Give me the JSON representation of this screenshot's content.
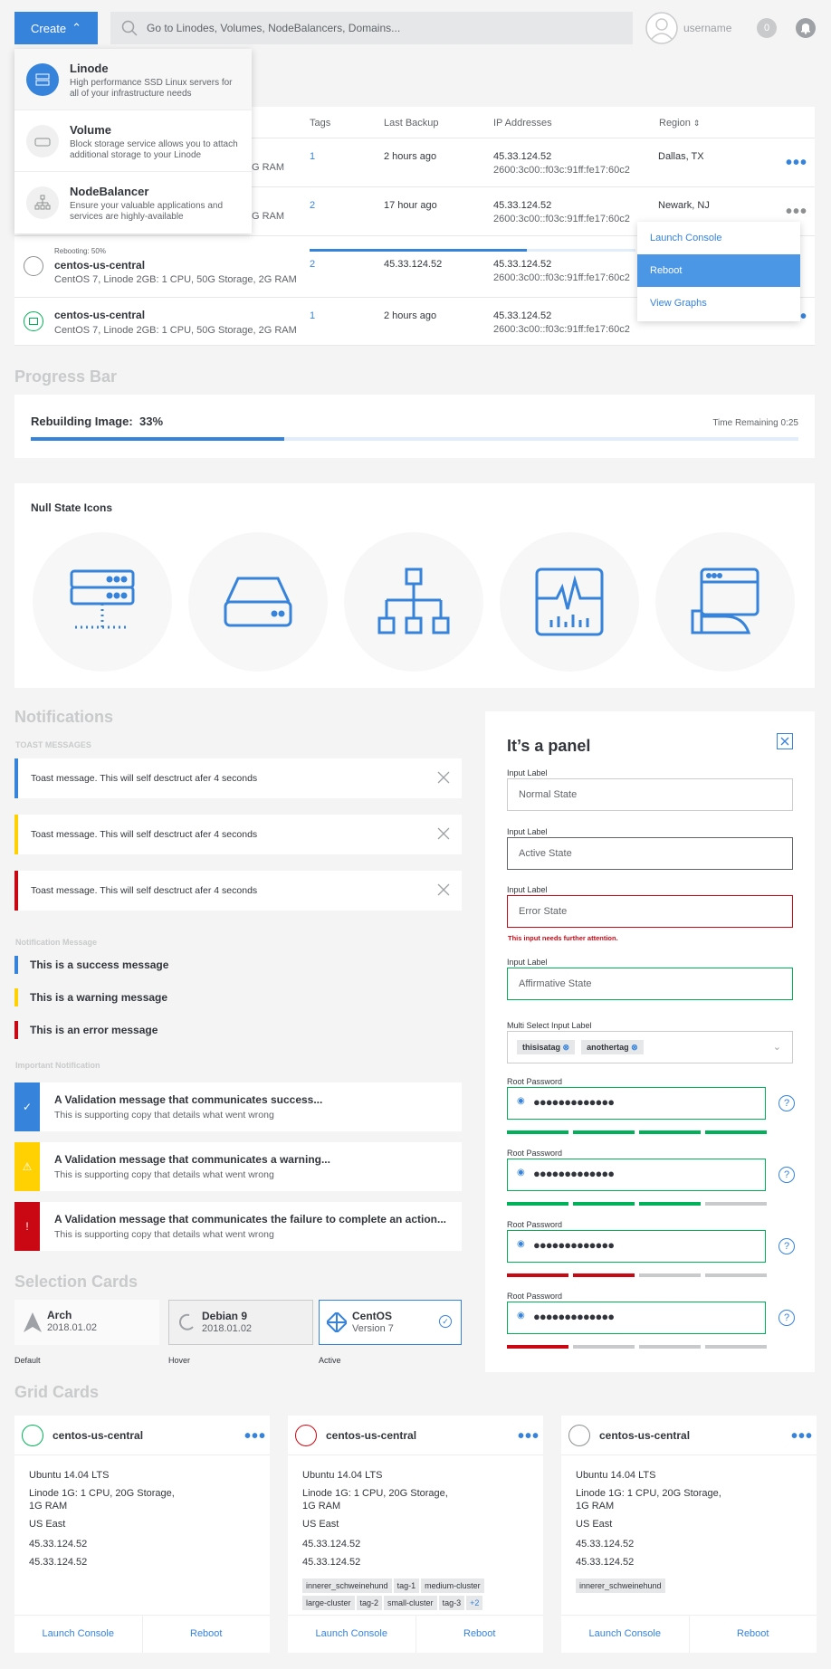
{
  "topbar": {
    "create": "Create",
    "search_placeholder": "Go to Linodes, Volumes, NodeBalancers, Domains...",
    "username": "username",
    "badge": "0"
  },
  "create_menu": [
    {
      "title": "Linode",
      "desc": "High performance SSD Linux servers for all of your infrastructure needs"
    },
    {
      "title": "Volume",
      "desc": "Block storage service allows you to attach additional storage to your Linode"
    },
    {
      "title": "NodeBalancer",
      "desc": "Ensure your valuable applications and services are highly-available"
    }
  ],
  "table": {
    "headers": {
      "tags": "Tags",
      "last_backup": "Last Backup",
      "ip": "IP Addresses",
      "region": "Region"
    },
    "rows": [
      {
        "hidden_sub": "G RAM",
        "tags": "1",
        "backup": "2 hours ago",
        "ip1": "45.33.124.52",
        "ip2": "2600:3c00::f03c:91ff:fe17:60c2",
        "region": "Dallas, TX"
      },
      {
        "hidden_sub": "G RAM",
        "tags": "2",
        "backup": "17 hour ago",
        "ip1": "45.33.124.52",
        "ip2": "2600:3c00::f03c:91ff:fe17:60c2",
        "region": "Newark, NJ"
      },
      {
        "status": "Rebooting: 50%",
        "name": "centos-us-central",
        "sub": "CentOS 7, Linode 2GB: 1 CPU, 50G Storage, 2G RAM",
        "tags": "2",
        "backup": "45.33.124.52",
        "ip1": "45.33.124.52",
        "ip2": "2600:3c00::f03c:91ff:fe17:60c2"
      },
      {
        "name": "centos-us-central",
        "sub": "CentOS 7, Linode 2GB: 1 CPU, 50G Storage, 2G RAM",
        "tags": "1",
        "backup": "2 hours ago",
        "ip1": "45.33.124.52",
        "ip2": "2600:3c00::f03c:91ff:fe17:60c2"
      }
    ]
  },
  "context_menu": [
    "Launch Console",
    "Reboot",
    "View Graphs"
  ],
  "progress": {
    "section": "Progress Bar",
    "label": "Rebuilding Image:",
    "percent_text": "33%",
    "value": 0.33,
    "remaining": "Time Remaining 0:25"
  },
  "null_state": {
    "title": "Null State Icons",
    "icons": [
      "linodes-icon",
      "volumes-icon",
      "nodebalancers-icon",
      "graphs-icon",
      "stackscripts-icon"
    ]
  },
  "notifications": {
    "section": "Notifications",
    "toast_label": "TOAST MESSAGES",
    "toasts": [
      "Toast message. This will self desctruct afer 4 seconds",
      "Toast message. This will self desctruct afer 4 seconds",
      "Toast message. This will self desctruct afer 4 seconds"
    ],
    "nm_label": "Notification Message",
    "messages": [
      "This is a success message",
      "This is a warning message",
      "This is an error message"
    ],
    "important_label": "Important Notification",
    "validations": [
      {
        "title": "A Validation message that communicates success...",
        "sub": "This is supporting copy that details what went wrong"
      },
      {
        "title": "A Validation message that communicates a warning...",
        "sub": "This is supporting copy that details what went wrong"
      },
      {
        "title": "A Validation message that communicates the failure to complete an action...",
        "sub": "This is supporting copy that details what went wrong"
      }
    ]
  },
  "panel": {
    "title": "It’s a panel",
    "inputs": [
      {
        "label": "Input Label",
        "value": "Normal State"
      },
      {
        "label": "Input Label",
        "value": "Active State"
      },
      {
        "label": "Input Label",
        "value": "Error State"
      },
      {
        "label": "Input Label",
        "value": "Affirmative State"
      }
    ],
    "error_text": "This input needs further attention.",
    "multi_label": "Multi Select Input Label",
    "tags": [
      "thisisatag",
      "anothertag"
    ],
    "pw_label": "Root Password",
    "pw_dots": "●●●●●●●●●●●●●",
    "strengths": [
      4,
      3,
      2,
      1
    ]
  },
  "selection": {
    "section": "Selection Cards",
    "cards": [
      {
        "title": "Arch",
        "sub": "2018.01.02",
        "caption": "Default"
      },
      {
        "title": "Debian 9",
        "sub": "2018.01.02",
        "caption": "Hover"
      },
      {
        "title": "CentOS",
        "sub": "Version 7",
        "caption": "Active"
      }
    ]
  },
  "grid": {
    "section": "Grid Cards",
    "cards": [
      {
        "name": "centos-us-central",
        "os": "Ubuntu 14.04 LTS",
        "plan1": "Linode 1G: 1 CPU, 20G Storage,",
        "plan2": "1G RAM",
        "region": "US East",
        "ip1": "45.33.124.52",
        "ip2": "45.33.124.52",
        "tags": [],
        "status": "#01b159"
      },
      {
        "name": "centos-us-central",
        "os": "Ubuntu 14.04 LTS",
        "plan1": "Linode 1G: 1 CPU, 20G Storage,",
        "plan2": "1G RAM",
        "region": "US East",
        "ip1": "45.33.124.52",
        "ip2": "45.33.124.52",
        "tags": [
          "innerer_schweinehund",
          "tag-1",
          "medium-cluster",
          "large-cluster",
          "tag-2",
          "small-cluster",
          "tag-3"
        ],
        "more": "+2",
        "status": "#ca0813"
      },
      {
        "name": "centos-us-central",
        "os": "Ubuntu 14.04 LTS",
        "plan1": "Linode 1G: 1 CPU, 20G Storage,",
        "plan2": "1G RAM",
        "region": "US East",
        "ip1": "45.33.124.52",
        "ip2": "45.33.124.52",
        "tags": [
          "innerer_schweinehund"
        ],
        "status": "#8d8f91"
      }
    ],
    "launch": "Launch Console",
    "reboot": "Reboot"
  },
  "colors": {
    "accent": "#3683dc",
    "success": "#01b159",
    "warning": "#ffd002",
    "error": "#ca0813"
  }
}
